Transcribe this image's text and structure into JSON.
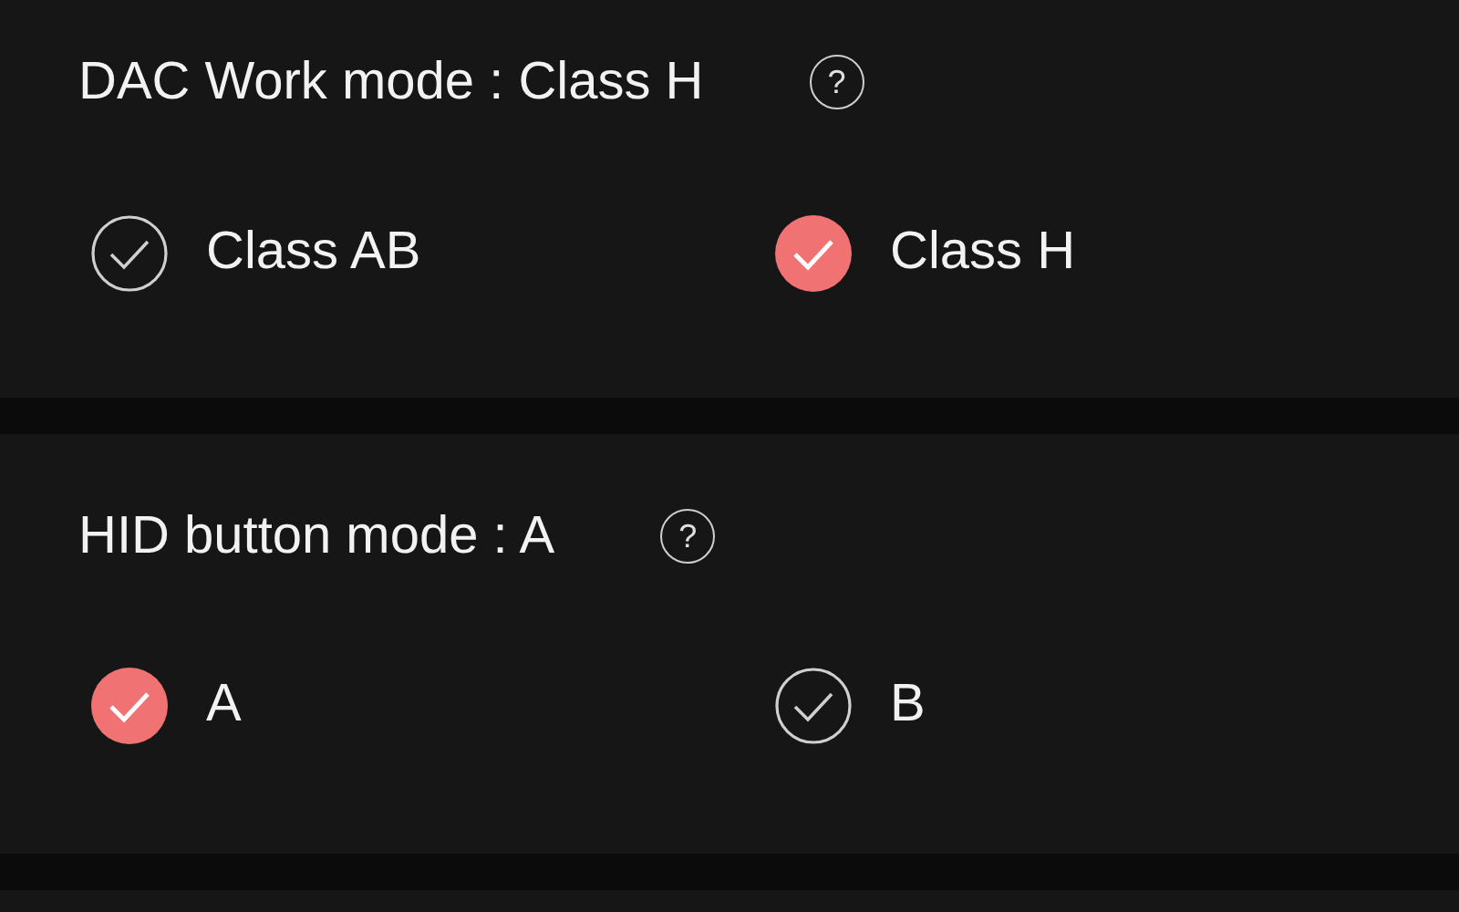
{
  "sections": [
    {
      "title": "DAC Work mode : Class H",
      "options": [
        {
          "label": "Class AB",
          "selected": false
        },
        {
          "label": "Class H",
          "selected": true
        }
      ]
    },
    {
      "title": "HID button mode : A",
      "options": [
        {
          "label": "A",
          "selected": true
        },
        {
          "label": "B",
          "selected": false
        }
      ]
    }
  ],
  "help_label": "?"
}
